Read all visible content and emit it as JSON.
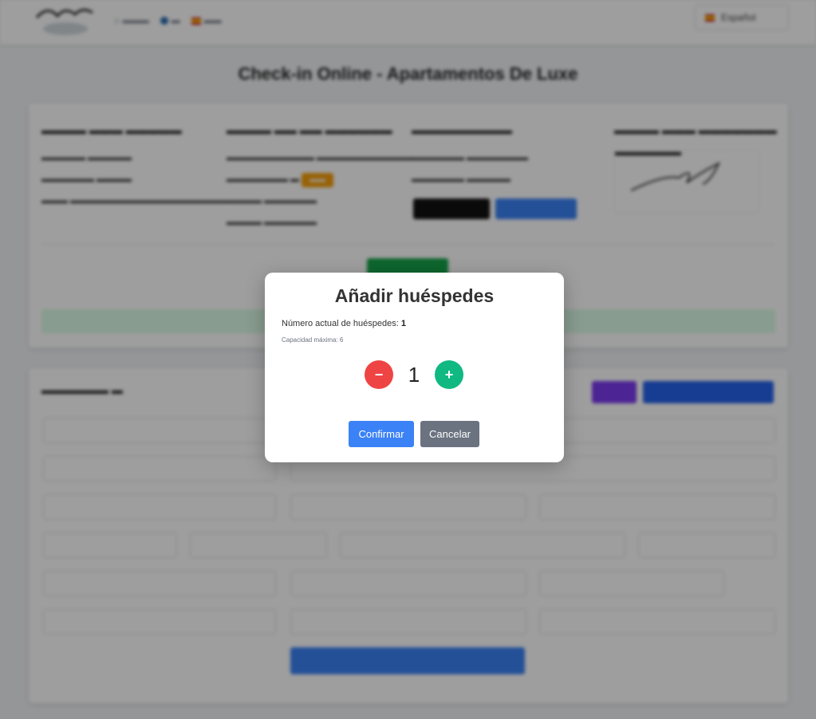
{
  "page": {
    "title": "Check-in Online - Apartamentos De Luxe",
    "language_selected": "Español"
  },
  "colors": {
    "accent_blue": "#3b82f6",
    "danger_red": "#ef4444",
    "success_green": "#10b981",
    "neutral_gray": "#6b7280",
    "badge_orange": "#f59e0b",
    "purple": "#7c3aed"
  },
  "modal": {
    "title": "Añadir huéspedes",
    "current_label": "Número actual de huéspedes:",
    "current_value": "1",
    "capacity_label": "Capacidad máxima: 6",
    "count": "1",
    "minus_symbol": "−",
    "plus_symbol": "+",
    "confirm_label": "Confirmar",
    "cancel_label": "Cancelar"
  }
}
